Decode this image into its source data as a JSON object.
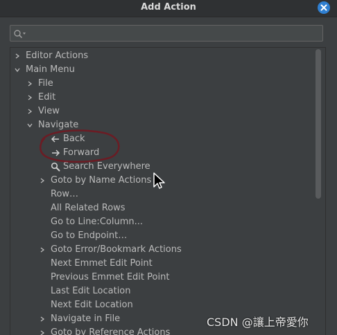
{
  "window": {
    "title": "Add Action",
    "close_icon": "close-icon"
  },
  "search": {
    "value": "",
    "placeholder": "",
    "icon": "search-icon"
  },
  "tree": {
    "items": [
      {
        "label": "Editor Actions",
        "level": 0,
        "expander": "collapsed"
      },
      {
        "label": "Main Menu",
        "level": 0,
        "expander": "expanded"
      },
      {
        "label": "File",
        "level": 1,
        "expander": "collapsed"
      },
      {
        "label": "Edit",
        "level": 1,
        "expander": "collapsed"
      },
      {
        "label": "View",
        "level": 1,
        "expander": "collapsed"
      },
      {
        "label": "Navigate",
        "level": 1,
        "expander": "expanded"
      },
      {
        "label": "Back",
        "level": 2,
        "icon": "arrow-left-icon"
      },
      {
        "label": "Forward",
        "level": 2,
        "icon": "arrow-right-icon"
      },
      {
        "label": "Search Everywhere",
        "level": 2,
        "icon": "search-icon"
      },
      {
        "label": "Goto by Name Actions",
        "level": 2,
        "expander": "collapsed"
      },
      {
        "label": "Row…",
        "level": 2
      },
      {
        "label": "All Related Rows",
        "level": 2
      },
      {
        "label": "Go to Line:Column...",
        "level": 2
      },
      {
        "label": "Go to Endpoint…",
        "level": 2
      },
      {
        "label": "Goto Error/Bookmark Actions",
        "level": 2,
        "expander": "collapsed"
      },
      {
        "label": "Next Emmet Edit Point",
        "level": 2
      },
      {
        "label": "Previous Emmet Edit Point",
        "level": 2
      },
      {
        "label": "Last Edit Location",
        "level": 2
      },
      {
        "label": "Next Edit Location",
        "level": 2
      },
      {
        "label": "Navigate in File",
        "level": 2,
        "expander": "collapsed"
      },
      {
        "label": "Goto by Reference Actions",
        "level": 2,
        "expander": "collapsed"
      }
    ]
  },
  "watermark": {
    "text": "CSDN @讓上帝愛你"
  },
  "colors": {
    "background": "#3c3f41",
    "text": "#bbbbbb",
    "annotation": "#6b1c24",
    "close_button": "#2f7fd1"
  }
}
